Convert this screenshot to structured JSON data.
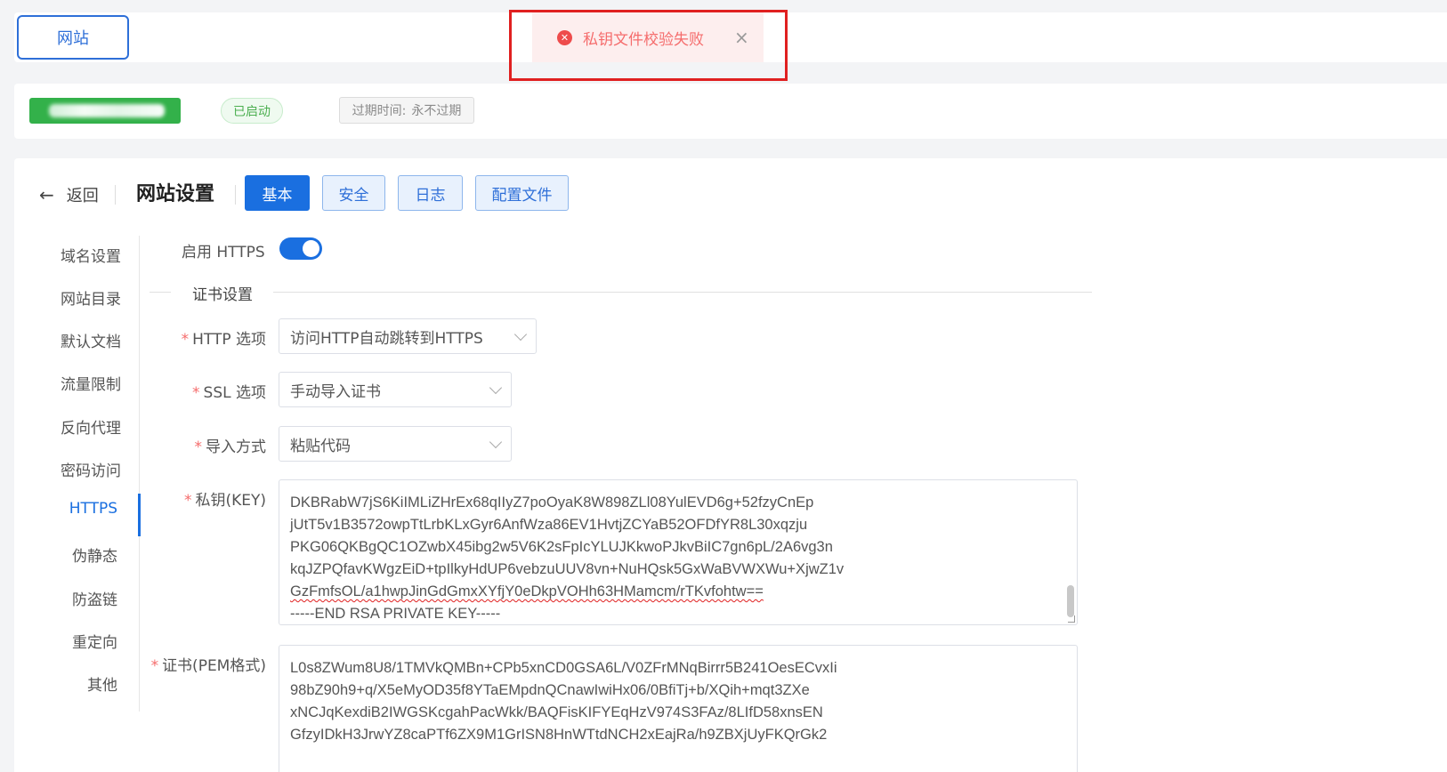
{
  "topbar": {
    "site_button": "网站"
  },
  "toast": {
    "message": "私钥文件校验失败",
    "icon": "error-circle-icon",
    "close": "×"
  },
  "info": {
    "status_badge": "已启动",
    "expiry_label": "过期时间:",
    "expiry_value": "永不过期"
  },
  "header": {
    "back_label": "返回",
    "title": "网站设置",
    "tabs": [
      {
        "label": "基本",
        "active": true
      },
      {
        "label": "安全",
        "active": false
      },
      {
        "label": "日志",
        "active": false
      },
      {
        "label": "配置文件",
        "active": false
      }
    ]
  },
  "sidebar": {
    "items": [
      {
        "label": "域名设置"
      },
      {
        "label": "网站目录"
      },
      {
        "label": "默认文档"
      },
      {
        "label": "流量限制"
      },
      {
        "label": "反向代理"
      },
      {
        "label": "密码访问"
      },
      {
        "label": "HTTPS",
        "active": true
      },
      {
        "label": "伪静态"
      },
      {
        "label": "防盗链"
      },
      {
        "label": "重定向"
      },
      {
        "label": "其他"
      }
    ]
  },
  "form": {
    "https_label": "启用 HTTPS",
    "https_enabled": true,
    "section_title": "证书设置",
    "http_option": {
      "label": "HTTP 选项",
      "value": "访问HTTP自动跳转到HTTPS"
    },
    "ssl_option": {
      "label": "SSL 选项",
      "value": "手动导入证书"
    },
    "import_method": {
      "label": "导入方式",
      "value": "粘贴代码"
    },
    "private_key": {
      "label": "私钥(KEY)",
      "lines": [
        "DKBRabW7jS6KiIMLiZHrEx68qIIyZ7poOyaK8W898ZLl08YulEVD6g+52fzyCnEp",
        "jUtT5v1B3572owpTtLrbKLxGyr6AnfWza86EV1HvtjZCYaB52OFDfYR8L30xqzju",
        "PKG06QKBgQC1OZwbX45ibg2w5V6K2sFpIcYLUJKkwoPJkvBiIC7gn6pL/2A6vg3n",
        "kqJZPQfavKWgzEiD+tpIlkyHdUP6vebzuUUV8vn+NuHQsk5GxWaBVWXWu+XjwZ1v",
        "GzFmfsOL/a1hwpJinGdGmxXYfjY0eDkpVOHh63HMamcm/rTKvfohtw==",
        "-----END RSA PRIVATE KEY-----"
      ]
    },
    "certificate": {
      "label": "证书(PEM格式)",
      "lines": [
        "L0s8ZWum8U8/1TMVkQMBn+CPb5xnCD0GSA6L/V0ZFrMNqBirrr5B241OesECvxIi",
        "98bZ90h9+q/X5eMyOD35f8YTaEMpdnQCnawIwiHx06/0BfiTj+b/XQih+mqt3ZXe",
        "xNCJqKexdiB2IWGSKcgahPacWkk/BAQFisKIFYEqHzV974S3FAz/8LIfD58xnsEN",
        "GfzyIDkH3JrwYZ8caPTf6ZX9M1GrISN8HnWTtdNCH2xEajRa/h9ZBXjUyFKQrGk2"
      ]
    }
  }
}
